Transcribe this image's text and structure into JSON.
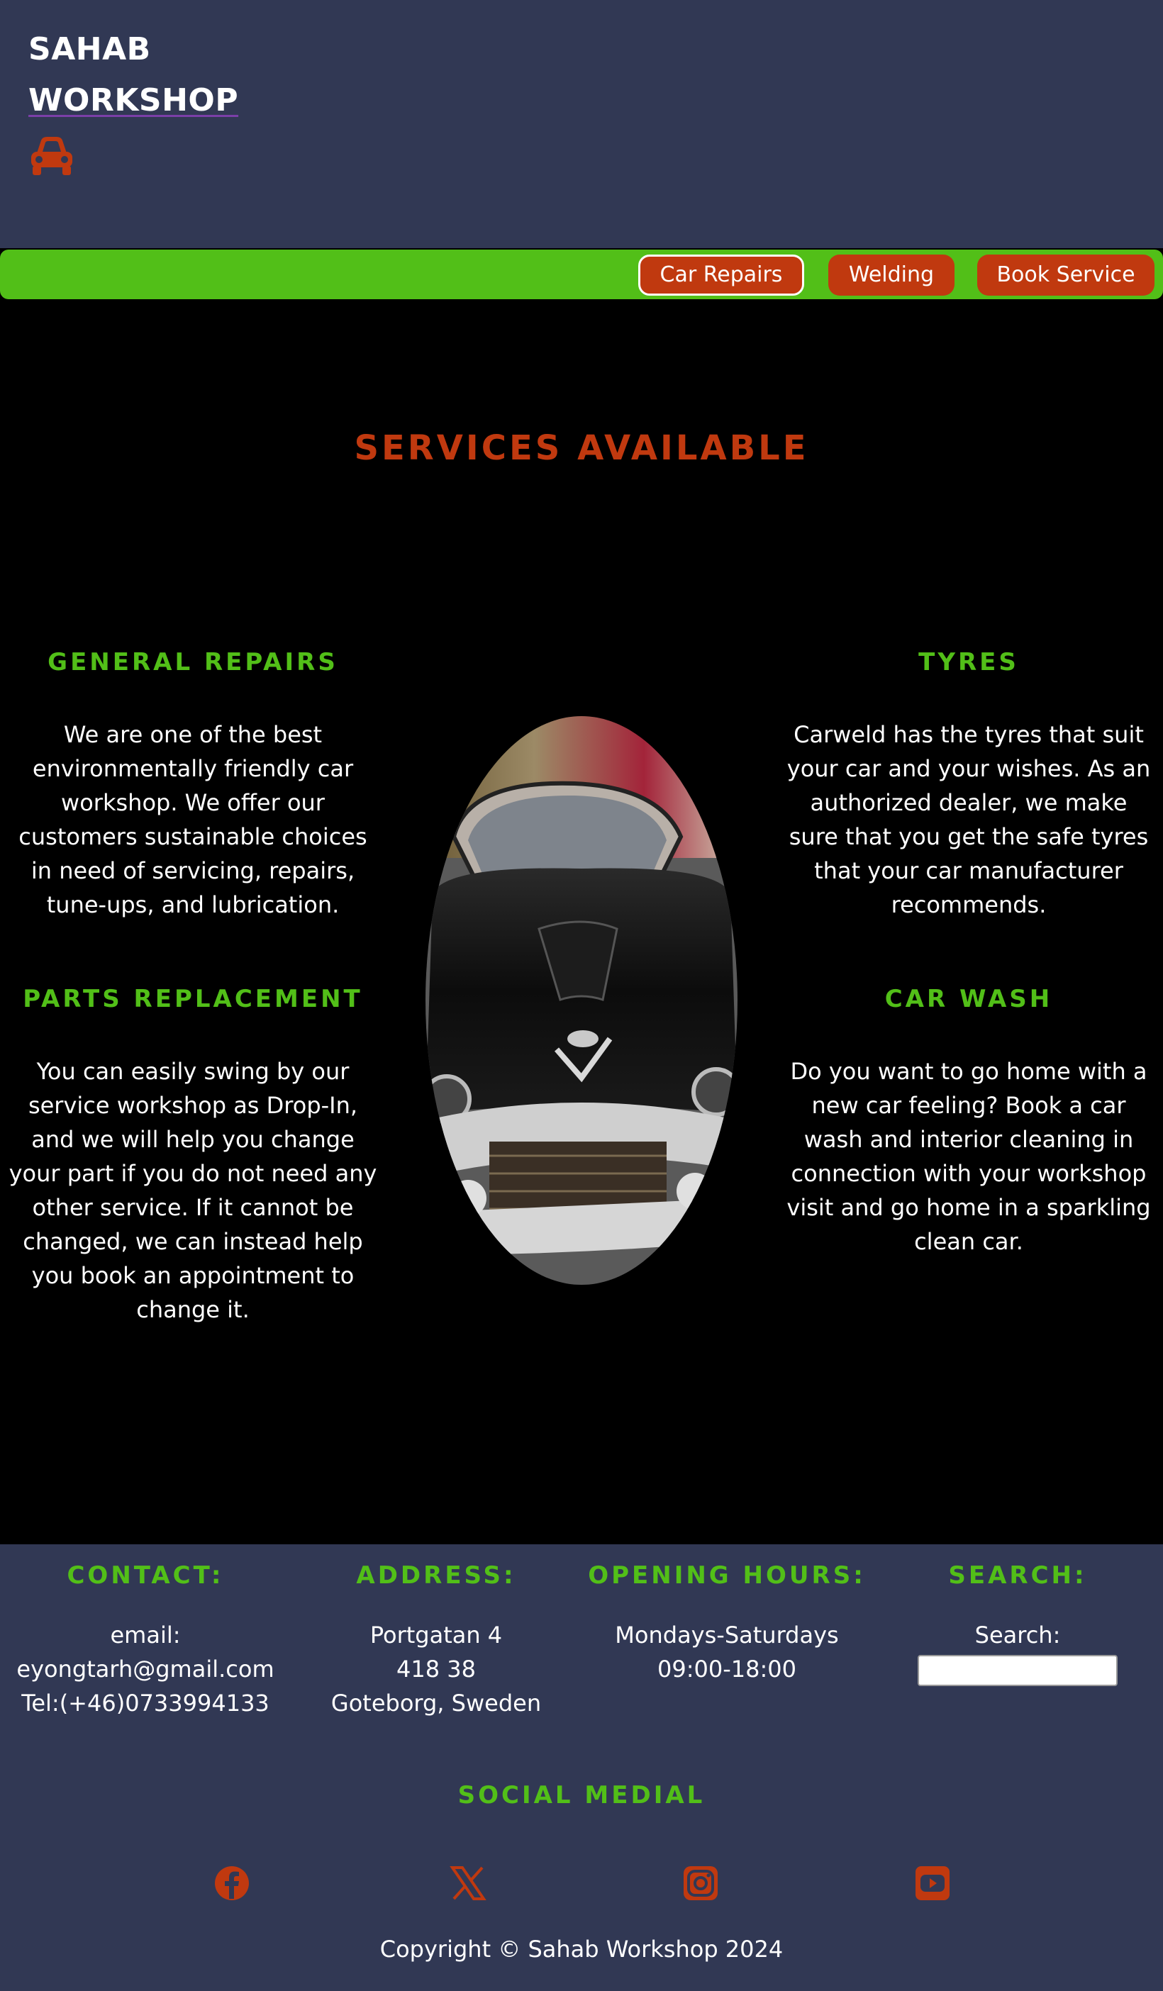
{
  "header": {
    "brand_line1": "SAHAB",
    "brand_line2": "WORKSHOP",
    "logo_icon": "car-icon"
  },
  "nav": {
    "items": [
      {
        "label": "Car Repairs",
        "active": true
      },
      {
        "label": "Welding",
        "active": false
      },
      {
        "label": "Book Service",
        "active": false
      }
    ]
  },
  "main": {
    "title": "SERVICES AVAILABLE",
    "services": [
      {
        "heading": "GENERAL REPAIRS",
        "text": "We are one of the best environmentally friendly car workshop. We offer our customers sustainable choices in need of servicing, repairs, tune-ups, and lubrication."
      },
      {
        "heading": "PARTS REPLACEMENT",
        "text": "You can easily swing by our service workshop as Drop-In, and we will help you change your part if you do not need any other service. If it cannot be changed, we can instead help you book an appointment to change it."
      },
      {
        "heading": "TYRES",
        "text": "Carweld has the tyres that suit your car and your wishes. As an authorized dealer, we make sure that you get the safe tyres that your car manufacturer recommends."
      },
      {
        "heading": "CAR WASH",
        "text": "Do you want to go home with a new car feeling? Book a car wash and interior cleaning in connection with your workshop visit and go home in a sparkling clean car."
      }
    ],
    "image_subject": "black-vintage-car"
  },
  "footer": {
    "contact": {
      "heading": "CONTACT:",
      "lines": [
        "email:",
        "eyongtarh@gmail.com",
        "Tel:(+46)0733994133"
      ]
    },
    "address": {
      "heading": "ADDRESS:",
      "lines": [
        "Portgatan 4",
        "418 38",
        "Goteborg, Sweden"
      ]
    },
    "hours": {
      "heading": "OPENING HOURS:",
      "lines": [
        "Mondays-Saturdays",
        "09:00-18:00"
      ]
    },
    "search": {
      "heading": "SEARCH:",
      "label": "Search:",
      "value": ""
    },
    "social_title": "SOCIAL MEDIAL",
    "social_icons": [
      "facebook-icon",
      "x-icon",
      "instagram-icon",
      "youtube-icon"
    ],
    "copyright": "Copyright © Sahab Workshop 2024"
  },
  "colors": {
    "header_bg": "#313854",
    "nav_bg": "#52bf18",
    "accent_orange": "#c0390f",
    "heading_green": "#52bf18",
    "main_bg": "#000000"
  }
}
